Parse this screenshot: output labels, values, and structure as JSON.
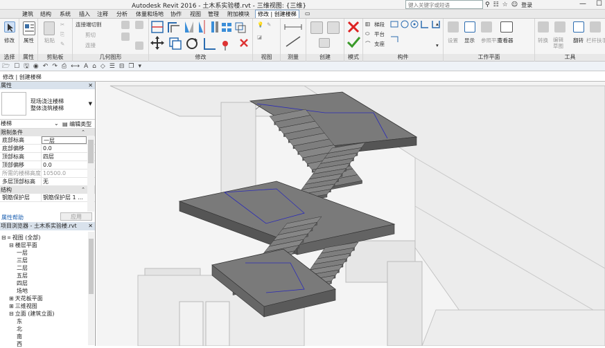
{
  "titlebar": {
    "title": "Autodesk Revit 2016 -    土木系实验楼.rvt - 三维视图: {三维}",
    "search_placeholder": "键入关键字或短语",
    "signin": "登录"
  },
  "tabs": [
    "建筑",
    "结构",
    "系统",
    "插入",
    "注释",
    "分析",
    "体量和场地",
    "协作",
    "视图",
    "管理",
    "附加模块",
    "修改 | 创建楼梯"
  ],
  "ribbon": {
    "groups": {
      "select": "选择",
      "properties": "属性",
      "clipboard": "剪贴板",
      "geometry": "几何图形",
      "modify": "修改",
      "view": "视图",
      "measure": "测量",
      "create": "创建",
      "mode": "模式",
      "components": "构件",
      "workplane": "工作平面",
      "tools": "工具"
    },
    "modify_label": "修改",
    "properties_label": "属性",
    "paste_label": "粘贴",
    "join_cut": "连接端切割",
    "cut": "剪切",
    "join": "连接",
    "run_label": "梯段",
    "landing_label": "平台",
    "support_label": "支座",
    "set_label": "设置",
    "show_label": "显示",
    "ref_plane_label": "参照平面",
    "viewer_label": "查看器",
    "convert_label": "转换",
    "edit_sketch_label": "编辑草图",
    "flip_label": "翻转",
    "railing_label": "栏杆扶手"
  },
  "context_bar": "修改 | 创建楼梯",
  "properties": {
    "header": "属性",
    "type_line1": "现场浇注楼梯",
    "type_line2": "整体浇筑楼梯",
    "selector": "楼梯",
    "edit_type": "编辑类型",
    "section_constraints": "限制条件",
    "rows": [
      {
        "k": "底部标高",
        "v": "一层"
      },
      {
        "k": "底部偏移",
        "v": "0.0"
      },
      {
        "k": "顶部标高",
        "v": "四层"
      },
      {
        "k": "顶部偏移",
        "v": "0.0"
      },
      {
        "k": "所需的楼梯高度",
        "v": "10500.0"
      },
      {
        "k": "多层顶部标高",
        "v": "无"
      }
    ],
    "section_structure": "结构",
    "rebar_row": {
      "k": "钢筋保护层",
      "v": "钢筋保护层 1 ..."
    },
    "help": "属性帮助",
    "apply": "应用"
  },
  "browser": {
    "header": "项目浏览器 - 土木系实验楼.rvt",
    "nodes": [
      {
        "label": "视图 (全部)",
        "indent": 0,
        "toggle": "⊟"
      },
      {
        "label": "楼层平面",
        "indent": 1,
        "toggle": "⊟"
      },
      {
        "label": "一层",
        "indent": 2,
        "toggle": ""
      },
      {
        "label": "三层",
        "indent": 2,
        "toggle": ""
      },
      {
        "label": "二层",
        "indent": 2,
        "toggle": ""
      },
      {
        "label": "五层",
        "indent": 2,
        "toggle": ""
      },
      {
        "label": "四层",
        "indent": 2,
        "toggle": ""
      },
      {
        "label": "场地",
        "indent": 2,
        "toggle": ""
      },
      {
        "label": "天花板平面",
        "indent": 1,
        "toggle": "⊞"
      },
      {
        "label": "三维视图",
        "indent": 1,
        "toggle": "⊞"
      },
      {
        "label": "立面 (建筑立面)",
        "indent": 1,
        "toggle": "⊟"
      },
      {
        "label": "东",
        "indent": 2,
        "toggle": ""
      },
      {
        "label": "北",
        "indent": 2,
        "toggle": ""
      },
      {
        "label": "南",
        "indent": 2,
        "toggle": ""
      },
      {
        "label": "西",
        "indent": 2,
        "toggle": ""
      }
    ]
  },
  "colors": {
    "accent": "#2b6cb0",
    "stair_fill": "#7a7a7a",
    "stair_dark": "#5a5a5a",
    "stair_light": "#8e8e8e",
    "sketch_line": "#2a2ab8"
  }
}
